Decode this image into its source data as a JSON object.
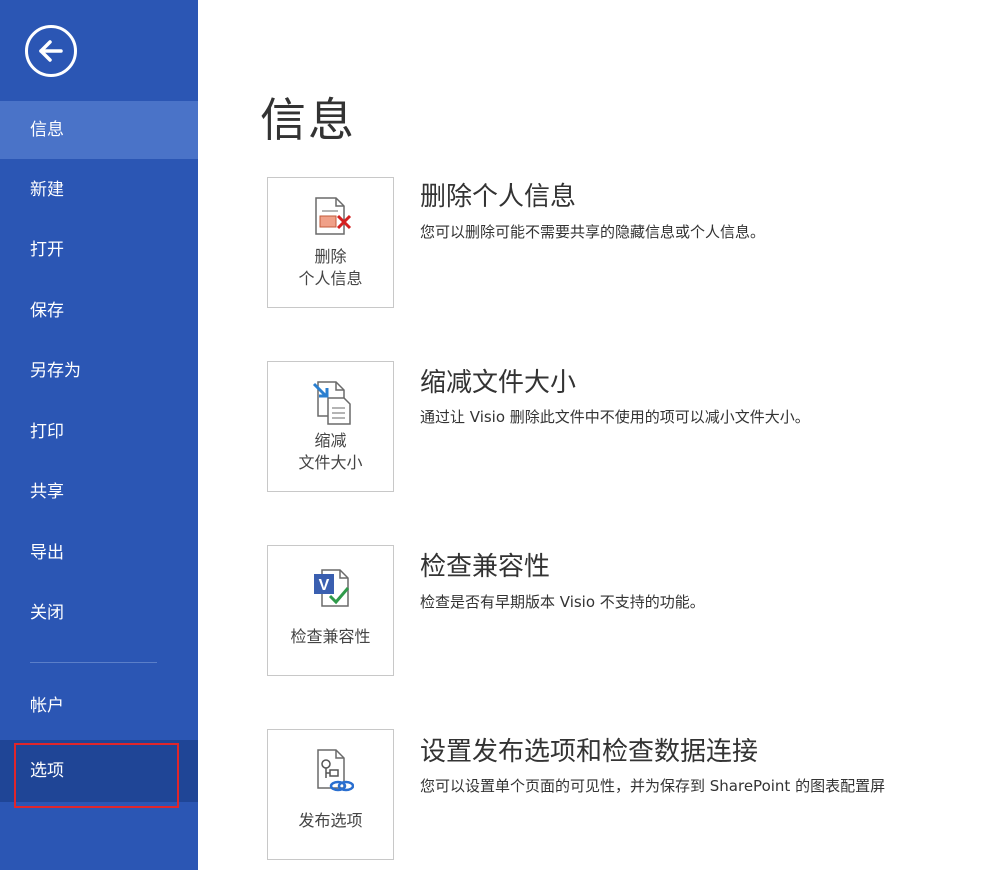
{
  "sidebar": {
    "back_icon": "back-arrow-icon",
    "items": [
      {
        "label": "信息"
      },
      {
        "label": "新建"
      },
      {
        "label": "打开"
      },
      {
        "label": "保存"
      },
      {
        "label": "另存为"
      },
      {
        "label": "打印"
      },
      {
        "label": "共享"
      },
      {
        "label": "导出"
      },
      {
        "label": "关闭"
      },
      {
        "label": "帐户"
      },
      {
        "label": "选项"
      }
    ],
    "active_item": "信息",
    "highlighted_item": "选项",
    "colors": {
      "background": "#2b56b4",
      "active": "#4a73c8",
      "highlight_border": "#e0262b"
    }
  },
  "main": {
    "title": "信息",
    "sections": [
      {
        "tile_line1": "删除",
        "tile_line2": "个人信息",
        "icon": "remove-personal-info-icon",
        "title": "删除个人信息",
        "description": "您可以删除可能不需要共享的隐藏信息或个人信息。"
      },
      {
        "tile_line1": "缩减",
        "tile_line2": "文件大小",
        "icon": "reduce-file-size-icon",
        "title": "缩减文件大小",
        "description": "通过让 Visio 删除此文件中不使用的项可以减小文件大小。"
      },
      {
        "tile_line1": "检查兼容性",
        "tile_line2": "",
        "icon": "check-compatibility-icon",
        "title": "检查兼容性",
        "description": "检查是否有早期版本 Visio 不支持的功能。"
      },
      {
        "tile_line1": "发布选项",
        "tile_line2": "",
        "icon": "publish-options-icon",
        "title": "设置发布选项和检查数据连接",
        "description": "您可以设置单个页面的可见性，并为保存到 SharePoint 的图表配置屏"
      }
    ]
  }
}
